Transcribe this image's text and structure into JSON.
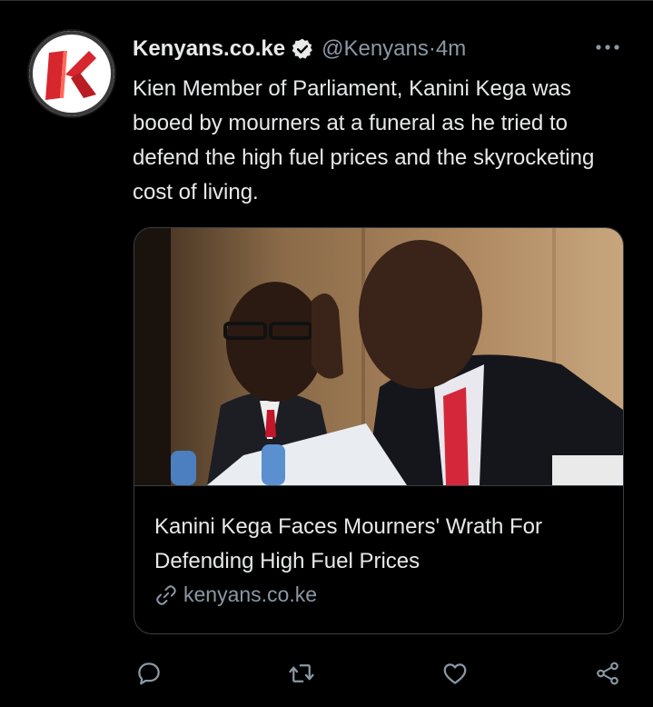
{
  "tweet": {
    "author_name": "Kenyans.co.ke",
    "handle": "@Kenyans",
    "separator": " · ",
    "time": "4m",
    "avatar_letter": "K",
    "text": "Kien Member of Parliament, Kanini Kega was booed by mourners at a funeral as he tried to defend the high fuel prices and the skyrocketing cost of living."
  },
  "card": {
    "title": "Kanini Kega Faces Mourners' Wrath For Defending High Fuel Prices",
    "domain": "kenyans.co.ke",
    "image_description_icon": "photo-two-men-at-hearing"
  },
  "actions": [
    {
      "name": "reply",
      "icon": "reply-icon"
    },
    {
      "name": "retweet",
      "icon": "retweet-icon"
    },
    {
      "name": "like",
      "icon": "heart-icon"
    },
    {
      "name": "share",
      "icon": "share-icon"
    }
  ],
  "colors": {
    "background": "#000000",
    "text": "#e7e9ea",
    "muted": "#8b98a5",
    "verified": "#e7e9ea",
    "brand_red": "#d8262e",
    "border": "#3a3f44"
  }
}
